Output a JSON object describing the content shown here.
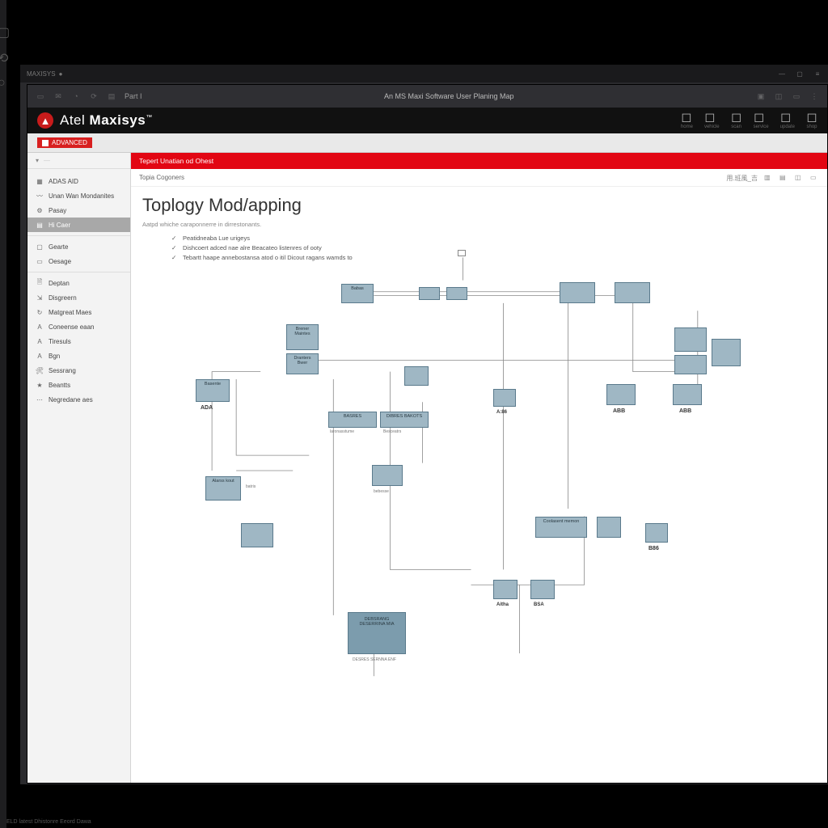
{
  "os": {
    "appname": "MAXISYS"
  },
  "browser": {
    "tabtitle": "Part I",
    "pagetitle": "An MS Maxi Software User Planing Map"
  },
  "brand": {
    "part1": "Atel ",
    "part2": "Maxisys",
    "tm": "™"
  },
  "brandicons": [
    "home",
    "vehicle",
    "scan",
    "service",
    "update",
    "shop"
  ],
  "subheader": {
    "chip": "ADVANCED"
  },
  "sidebar": {
    "crumb_icon": "▾",
    "items": [
      {
        "icon": "grid",
        "label": "ADAS AID"
      },
      {
        "icon": "wave",
        "label": "Unan Wan Mondanites"
      },
      {
        "icon": "gear",
        "label": "Pasay"
      },
      {
        "icon": "list",
        "label": "Hi Caer",
        "selected": true
      },
      {
        "icon": "box",
        "label": "Gearte"
      },
      {
        "icon": "dash",
        "label": "Oesage"
      },
      {
        "icon": "doc",
        "label": "Deptan"
      },
      {
        "icon": "flow",
        "label": "Disgreern"
      },
      {
        "icon": "ref",
        "label": "Matgreat Maes"
      },
      {
        "icon": "a",
        "label": "Coneense eaan"
      },
      {
        "icon": "a",
        "label": "Tiresuls"
      },
      {
        "icon": "a",
        "label": "Bgn"
      },
      {
        "icon": "tool",
        "label": "Sessrang"
      },
      {
        "icon": "star",
        "label": "Beantts"
      },
      {
        "icon": "more",
        "label": "Negredane aes"
      }
    ]
  },
  "redbar": "Tepert Unatian od Ohest",
  "tabs": "Topia Cogoners",
  "page": {
    "title": "Toplogy Mod/apping",
    "subtitle": "Aatpd whiche caraponnerre in dirrestonants.",
    "features": [
      "Peatidneaba Lue urigeys",
      "Dishcoert adced nae alre Beacateo listenres of ooty",
      "Tebartt haape annebostansa atod o itil Dicout ragans wamds to"
    ]
  },
  "toolbar_text": "用.班風_吉",
  "nodes": {
    "src": "",
    "n1": "Babas",
    "n2": "",
    "n3": "",
    "n4": "",
    "n5": "Brener Maintes",
    "n6": "Dranters Bwer",
    "n7": "",
    "n8": "Basente",
    "n9": "Alarss kout",
    "n10": "BASRES",
    "n11": "DIBRES BAKOTS",
    "n12": "Besceatrs",
    "n13": "",
    "n14": "",
    "n15": "",
    "n16": "Coolasent memon",
    "n17": "",
    "n18": "",
    "n19": "Aitha",
    "n20": "BSA",
    "big": "DEBSRANG DESERRINA MIA",
    "tinylabels": {
      "ADA": "ADA",
      "ABB": "ABB",
      "ABB2": "ABB",
      "AE6": "A:86",
      "BB6": "B86",
      "bat": "batris",
      "bebe": "bebesse"
    }
  },
  "footer": "ELD latest   Dhistonre   Eeord Dawa"
}
